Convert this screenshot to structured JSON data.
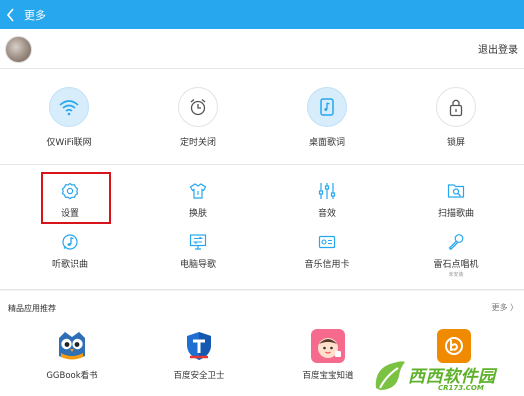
{
  "titlebar": {
    "title": "更多"
  },
  "user": {
    "logout_label": "退出登录"
  },
  "quick_toggles": [
    {
      "label": "仅WiFi联网",
      "icon": "wifi-icon",
      "active": true
    },
    {
      "label": "定时关闭",
      "icon": "alarm-clock-icon",
      "active": false
    },
    {
      "label": "桌面歌词",
      "icon": "desktop-lyrics-icon",
      "active": true
    },
    {
      "label": "锁屏",
      "icon": "lock-icon",
      "active": false
    }
  ],
  "grid_items": [
    {
      "label": "设置",
      "icon": "gear-icon"
    },
    {
      "label": "换肤",
      "icon": "tshirt-icon"
    },
    {
      "label": "音效",
      "icon": "equalizer-icon"
    },
    {
      "label": "扫描歌曲",
      "icon": "scan-folder-icon"
    },
    {
      "label": "听歌识曲",
      "icon": "music-recognition-icon"
    },
    {
      "label": "电脑导歌",
      "icon": "computer-transfer-icon"
    },
    {
      "label": "音乐信用卡",
      "icon": "credit-card-icon"
    },
    {
      "label": "雷石点唱机",
      "icon": "microphone-icon",
      "sub": "未安装"
    }
  ],
  "recommend": {
    "title": "精品应用推荐",
    "more_label": "更多",
    "apps": [
      {
        "label": "GGBook看书",
        "icon": "owl-app-icon"
      },
      {
        "label": "百度安全卫士",
        "icon": "shield-app-icon"
      },
      {
        "label": "百度宝宝知道",
        "icon": "baby-app-icon"
      },
      {
        "label": "",
        "icon": "orange-app-icon"
      }
    ]
  },
  "watermark": {
    "brand": "西西软件园",
    "url": "CR173.COM"
  },
  "colors": {
    "accent": "#27a7ee",
    "highlight": "#d9131a",
    "watermark": "#5fb12c"
  }
}
